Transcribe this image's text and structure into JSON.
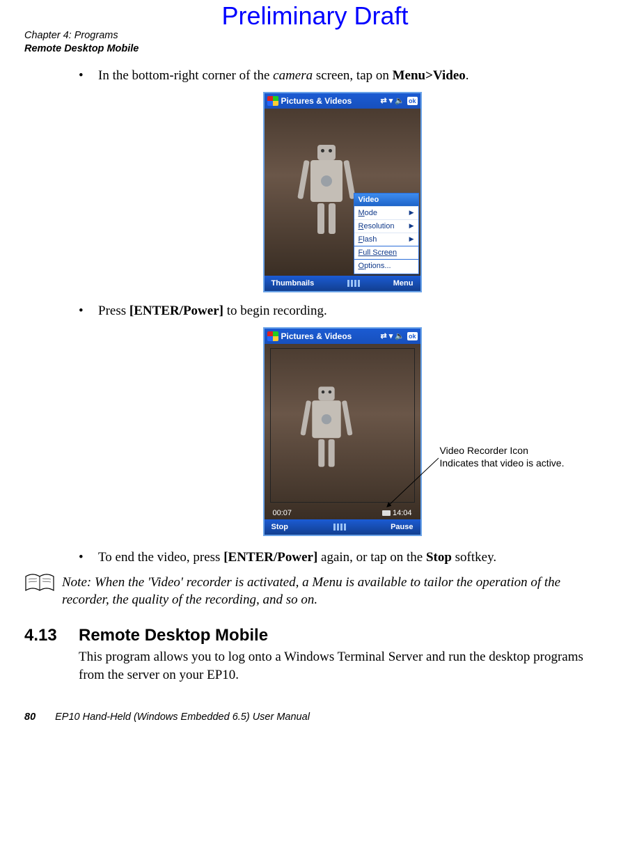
{
  "watermark": "Preliminary Draft",
  "running_head": {
    "line1": "Chapter 4: Programs",
    "line2": "Remote Desktop Mobile"
  },
  "bullets": {
    "b1_pre": "In the bottom-right corner of the ",
    "b1_em": "camera",
    "b1_mid": " screen, tap on ",
    "b1_bold": "Menu>Video",
    "b1_post": ".",
    "b2_pre": "Press ",
    "b2_bold": "[ENTER/Power]",
    "b2_post": " to begin recording.",
    "b3_pre": "To end the video, press ",
    "b3_bold1": "[ENTER/Power]",
    "b3_mid": " again, or tap on the ",
    "b3_bold2": "Stop",
    "b3_post": " softkey."
  },
  "fig1": {
    "title": "Pictures & Videos",
    "ok": "ok",
    "menu_header": "Video",
    "menu": {
      "mode": "Mode",
      "resolution": "Resolution",
      "flash": "Flash",
      "fullscreen": "Full Screen",
      "options": "Options..."
    },
    "soft_left": "Thumbnails",
    "soft_right": "Menu"
  },
  "fig2": {
    "title": "Pictures & Videos",
    "ok": "ok",
    "elapsed": "00:07",
    "remaining": "14:04",
    "soft_left": "Stop",
    "soft_right": "Pause",
    "callout": "Video Recorder Icon Indicates that video is active."
  },
  "note": {
    "lead": "Note: ",
    "text": "When the 'Video' recorder is activated, a Menu is available to tailor the operation of the recorder, the quality of the recording, and so on."
  },
  "section": {
    "num": "4.13",
    "title": "Remote Desktop Mobile",
    "body": "This program allows you to log onto a Windows Terminal Server and run the desktop programs from the server on your EP10."
  },
  "footer": {
    "page": "80",
    "title": "EP10 Hand-Held (Windows Embedded 6.5) User Manual"
  }
}
